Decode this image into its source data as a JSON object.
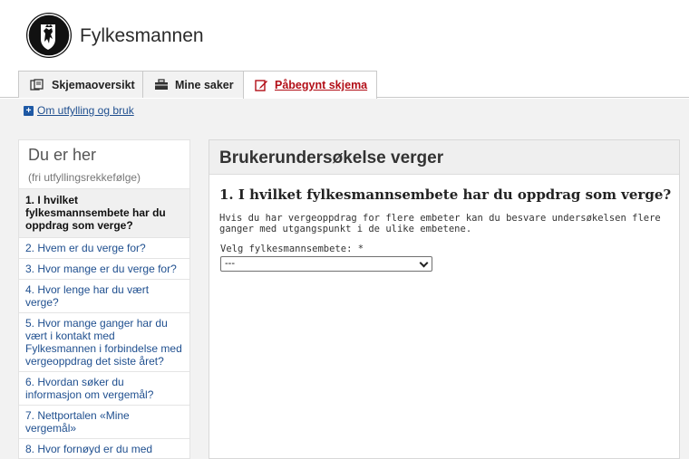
{
  "app": {
    "title": "Fylkesmannen",
    "logo_icon": "norway-lion-crest-icon"
  },
  "tabs": [
    {
      "label": "Skjemaoversikt",
      "icon": "files-icon"
    },
    {
      "label": "Mine saker",
      "icon": "briefcase-icon"
    },
    {
      "label": "Påbegynt skjema",
      "icon": "edit-icon",
      "active": true
    }
  ],
  "infobar": {
    "link": "Om utfylling og bruk",
    "icon": "plus-icon"
  },
  "sidebar": {
    "title": "Du er her",
    "subtitle": "(fri utfyllingsrekkefølge)",
    "items": [
      {
        "label": "1. I hvilket fylkesmannsembete har du oppdrag som verge?",
        "active": true
      },
      {
        "label": "2. Hvem er du verge for?"
      },
      {
        "label": "3. Hvor mange er du verge for?"
      },
      {
        "label": "4. Hvor lenge har du vært verge?"
      },
      {
        "label": "5. Hvor mange ganger har du vært i kontakt med Fylkesmannen i forbindelse med vergeoppdrag det siste året?"
      },
      {
        "label": "6. Hvordan søker du informasjon om vergemål?"
      },
      {
        "label": "7. Nettportalen «Mine vergemål»"
      },
      {
        "label": "8. Hvor fornøyd er du med"
      }
    ]
  },
  "main": {
    "heading": "Brukerundersøkelse verger",
    "question_title": "1. I hvilket fylkesmannsembete har du oppdrag som verge?",
    "help_text": "Hvis du har vergeoppdrag for flere embeter kan du besvare undersøkelsen flere ganger med utgangspunkt i de ulike embetene.",
    "field_label": "Velg fylkesmannsembete: *",
    "select_value": "---"
  },
  "colors": {
    "active_tab_text": "#b20e17",
    "link": "#1f4f8f",
    "background": "#f2f2f2"
  }
}
